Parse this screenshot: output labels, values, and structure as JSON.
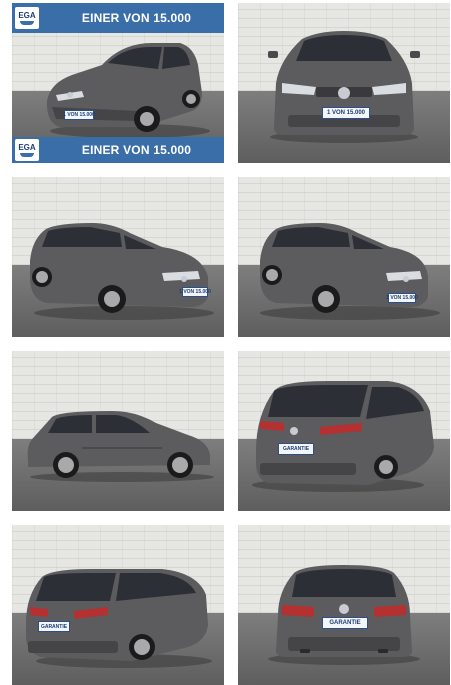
{
  "banner": {
    "top_text": "EINER VON 15.000",
    "bottom_text": "EINER VON 15.000",
    "logo_text": "EGA"
  },
  "plates": {
    "front": "1 VON 15.000",
    "rear": "GARANTIE"
  },
  "colors": {
    "banner": "#3a6ea8",
    "car_body": "#5b5b5d",
    "background": "#ffffff"
  }
}
